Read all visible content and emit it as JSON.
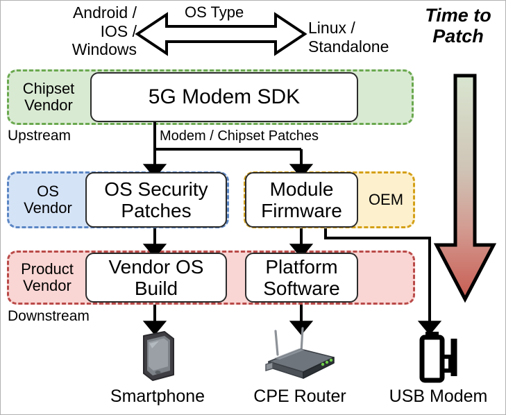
{
  "diagram": {
    "title_arrow": {
      "label": "OS Type",
      "left_text": "Android /\nIOS /\nWindows",
      "right_text": "Linux /\nStandalone",
      "icon": "double-headed-horizontal-arrow"
    },
    "time_to_patch": {
      "label": "Time to\nPatch",
      "icon": "down-arrow",
      "color_top": "#d9e5d0",
      "color_bottom": "#cc6157"
    },
    "flow_labels": {
      "upstream": "Upstream",
      "downstream": "Downstream"
    },
    "bands": [
      {
        "id": "chipset-vendor",
        "label": "Chipset\nVendor",
        "fill": "#d9ead3",
        "stroke": "#6aa84f"
      },
      {
        "id": "os-vendor",
        "label": "OS\nVendor",
        "fill": "#d5e3f7",
        "stroke": "#5b86c4"
      },
      {
        "id": "oem",
        "label": "OEM",
        "fill": "#fdf0cd",
        "stroke": "#d4a017"
      },
      {
        "id": "product-vendor",
        "label": "Product\nVendor",
        "fill": "#f9d5d3",
        "stroke": "#b94a48"
      }
    ],
    "nodes": [
      {
        "id": "sdk",
        "label": "5G Modem SDK",
        "font_size": 30
      },
      {
        "id": "os-security-patches",
        "label": "OS Security\nPatches",
        "font_size": 28
      },
      {
        "id": "module-firmware",
        "label": "Module\nFirmware",
        "font_size": 28
      },
      {
        "id": "vendor-os-build",
        "label": "Vendor OS\nBuild",
        "font_size": 28
      },
      {
        "id": "platform-software",
        "label": "Platform\nSoftware",
        "font_size": 28
      }
    ],
    "edges": [
      {
        "id": "modem-chipset-patches",
        "label": "Modem / Chipset Patches"
      }
    ],
    "devices": [
      {
        "id": "smartphone",
        "label": "Smartphone",
        "icon": "smartphone-icon"
      },
      {
        "id": "cpe-router",
        "label": "CPE Router",
        "icon": "router-icon"
      },
      {
        "id": "usb-modem",
        "label": "USB Modem",
        "icon": "usb-modem-icon"
      }
    ]
  }
}
